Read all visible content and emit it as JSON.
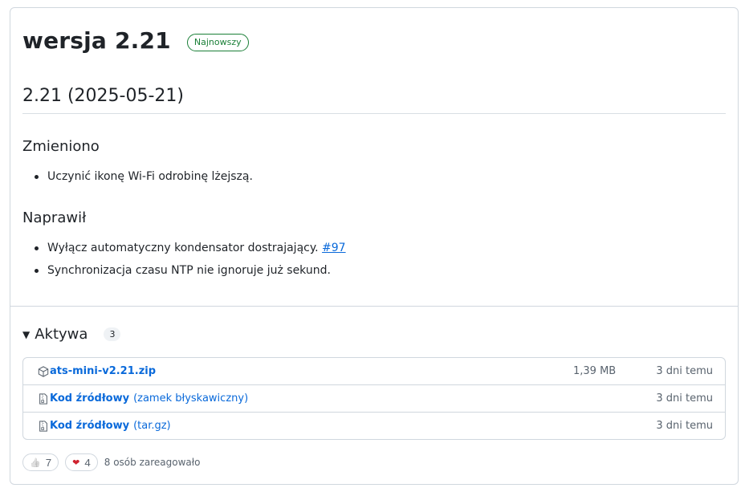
{
  "release": {
    "title": "wersja 2.21",
    "badge": "Najnowszy"
  },
  "notes": {
    "version_heading": "2.21 (2025-05-21)",
    "changed_heading": "Zmieniono",
    "changed_items": [
      "Uczynić ikonę Wi-Fi odrobinę lżejszą."
    ],
    "fixed_heading": "Naprawił",
    "fixed_items": [
      {
        "text": "Wyłącz automatyczny kondensator dostrajający.",
        "link": "#97"
      },
      {
        "text": "Synchronizacja czasu NTP nie ignoruje już sekund."
      }
    ]
  },
  "assets": {
    "title": "Aktywa",
    "count": "3",
    "items": [
      {
        "icon": "package-icon",
        "name": "ats-mini-v2.21.zip",
        "extra": "",
        "size": "1,39 MB",
        "date": "3 dni temu"
      },
      {
        "icon": "file-zip-icon",
        "name": "Kod źródłowy",
        "extra": "(zamek błyskawiczny)",
        "size": "",
        "date": "3 dni temu"
      },
      {
        "icon": "file-zip-icon",
        "name": "Kod źródłowy",
        "extra": "(tar.gz)",
        "size": "",
        "date": "3 dni temu"
      }
    ]
  },
  "reactions": {
    "items": [
      {
        "emoji": "👍",
        "icon": "thumbs-up-icon",
        "count": "7"
      },
      {
        "emoji": "❤",
        "icon": "heart-icon",
        "count": "4"
      }
    ],
    "summary": "8 osób zareagowało"
  },
  "colors": {
    "link": "#0969da",
    "badge_green": "#1a7f37",
    "border": "#d0d7de",
    "heart": "#cf222e"
  }
}
